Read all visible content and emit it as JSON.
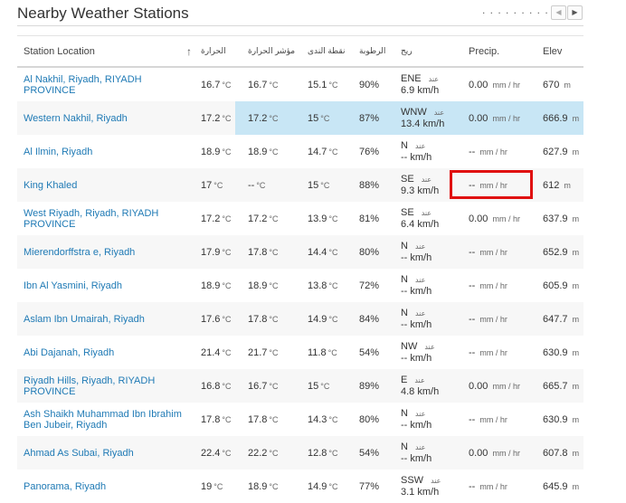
{
  "header": {
    "title": "Nearby Weather Stations",
    "pager_dots": ". . . . . . . . . .",
    "prev_label": "◀",
    "next_label": "▶"
  },
  "columns": {
    "location": "Station Location",
    "sort_indicator": "↑",
    "temp": "الحرارة",
    "feels": "مؤشر الحرارة",
    "dew": "نقطة الندى",
    "humidity": "الرطوبة",
    "wind": "ريح",
    "precip": "Precip.",
    "elev": "Elev"
  },
  "units": {
    "temp": "°C",
    "humidity": "%",
    "wind": "km/h",
    "precip": "mm / hr",
    "elev": "m",
    "wind_from": "عند"
  },
  "rows": [
    {
      "location": "Al Nakhil, Riyadh, RIYADH PROVINCE",
      "temp": "16.7",
      "feels": "16.7",
      "dew": "15.1",
      "humidity": "90",
      "wind_dir": "ENE",
      "wind_speed": "6.9",
      "precip": "0.00",
      "elev": "670"
    },
    {
      "location": "Western Nakhil, Riyadh",
      "temp": "17.2",
      "feels": "17.2",
      "dew": "15",
      "humidity": "87",
      "wind_dir": "WNW",
      "wind_speed": "13.4",
      "precip": "0.00",
      "elev": "666.9"
    },
    {
      "location": "Al Ilmin, Riyadh",
      "temp": "18.9",
      "feels": "18.9",
      "dew": "14.7",
      "humidity": "76",
      "wind_dir": "N",
      "wind_speed": "--",
      "precip": "--",
      "elev": "627.9"
    },
    {
      "location": "King Khaled",
      "temp": "17",
      "feels": "--",
      "dew": "15",
      "humidity": "88",
      "wind_dir": "SE",
      "wind_speed": "9.3",
      "precip": "--",
      "elev": "612"
    },
    {
      "location": "West Riyadh, Riyadh, RIYADH PROVINCE",
      "temp": "17.2",
      "feels": "17.2",
      "dew": "13.9",
      "humidity": "81",
      "wind_dir": "SE",
      "wind_speed": "6.4",
      "precip": "0.00",
      "elev": "637.9"
    },
    {
      "location": "Mierendorffstra e, Riyadh",
      "temp": "17.9",
      "feels": "17.8",
      "dew": "14.4",
      "humidity": "80",
      "wind_dir": "N",
      "wind_speed": "--",
      "precip": "--",
      "elev": "652.9"
    },
    {
      "location": "Ibn Al Yasmini, Riyadh",
      "temp": "18.9",
      "feels": "18.9",
      "dew": "13.8",
      "humidity": "72",
      "wind_dir": "N",
      "wind_speed": "--",
      "precip": "--",
      "elev": "605.9"
    },
    {
      "location": "Aslam Ibn Umairah, Riyadh",
      "temp": "17.6",
      "feels": "17.8",
      "dew": "14.9",
      "humidity": "84",
      "wind_dir": "N",
      "wind_speed": "--",
      "precip": "--",
      "elev": "647.7"
    },
    {
      "location": "Abi Dajanah, Riyadh",
      "temp": "21.4",
      "feels": "21.7",
      "dew": "11.8",
      "humidity": "54",
      "wind_dir": "NW",
      "wind_speed": "--",
      "precip": "--",
      "elev": "630.9"
    },
    {
      "location": "Riyadh Hills, Riyadh, RIYADH PROVINCE",
      "temp": "16.8",
      "feels": "16.7",
      "dew": "15",
      "humidity": "89",
      "wind_dir": "E",
      "wind_speed": "4.8",
      "precip": "0.00",
      "elev": "665.7"
    },
    {
      "location": "Ash Shaikh Muhammad Ibn Ibrahim Ben Jubeir, Riyadh",
      "temp": "17.8",
      "feels": "17.8",
      "dew": "14.3",
      "humidity": "80",
      "wind_dir": "N",
      "wind_speed": "--",
      "precip": "--",
      "elev": "630.9"
    },
    {
      "location": "Ahmad As Subai, Riyadh",
      "temp": "22.4",
      "feels": "22.2",
      "dew": "12.8",
      "humidity": "54",
      "wind_dir": "N",
      "wind_speed": "--",
      "precip": "0.00",
      "elev": "607.8"
    },
    {
      "location": "Panorama, Riyadh",
      "temp": "19",
      "feels": "18.9",
      "dew": "14.9",
      "humidity": "77",
      "wind_dir": "SSW",
      "wind_speed": "3.1",
      "precip": "--",
      "elev": "645.9"
    }
  ],
  "highlighted_row_index": 1,
  "red_box_row_index": 3,
  "colors": {
    "link": "#1f7ab5",
    "highlight": "#c8e6f5",
    "annotation_red": "#e01010"
  }
}
